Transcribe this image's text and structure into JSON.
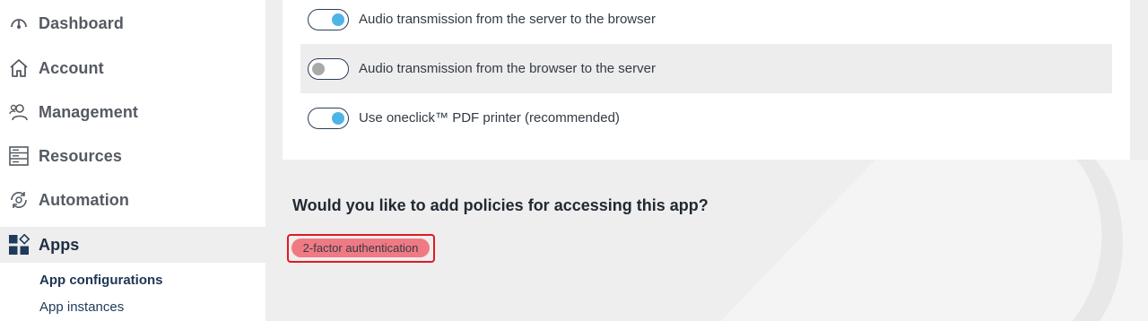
{
  "sidebar": {
    "items": [
      {
        "label": "Dashboard",
        "icon": "gauge-icon"
      },
      {
        "label": "Account",
        "icon": "home-icon"
      },
      {
        "label": "Management",
        "icon": "users-icon"
      },
      {
        "label": "Resources",
        "icon": "server-icon"
      },
      {
        "label": "Automation",
        "icon": "gear-cycle-icon"
      },
      {
        "label": "Apps",
        "icon": "apps-icon"
      }
    ],
    "subitems": [
      {
        "label": "App configurations"
      },
      {
        "label": "App instances"
      }
    ]
  },
  "settings": {
    "rows": [
      {
        "label": "Audio transmission from the server to the browser",
        "enabled": true
      },
      {
        "label": "Audio transmission from the browser to the server",
        "enabled": false
      },
      {
        "label": "Use oneclick™ PDF printer (recommended)",
        "enabled": true
      }
    ]
  },
  "policies": {
    "question": "Would you like to add policies for accessing this app?",
    "chip_label": "2-factor authentication"
  },
  "colors": {
    "toggle_on": "#4db5e6",
    "toggle_off": "#a9a9a9",
    "chip": "#f07a84",
    "highlight_frame": "#e01a22",
    "nav_active_text": "#1f2d44"
  }
}
